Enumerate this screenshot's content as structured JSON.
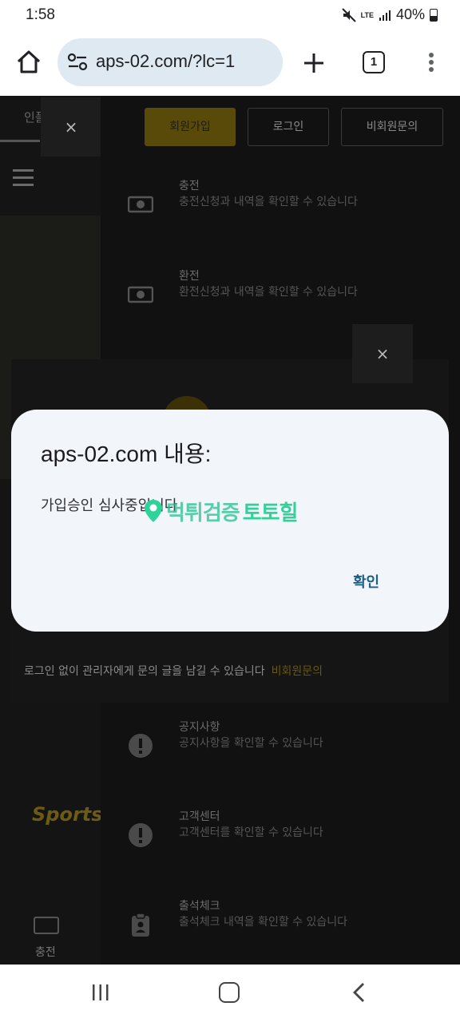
{
  "status_bar": {
    "time": "1:58",
    "network": "LTE",
    "battery": "40%"
  },
  "browser": {
    "url": "aps-02.com/?lc=1",
    "tab_count": "1"
  },
  "page": {
    "left_strip": {
      "tab_label": "인플",
      "sports_label": "Sports",
      "footer_label": "충전"
    },
    "close_symbol": "×",
    "auth_buttons": {
      "signup": "회원가입",
      "login": "로그인",
      "guest_inquiry": "비회원문의"
    },
    "menu_items": [
      {
        "title": "충전",
        "desc": "충전신청과 내역을 확인할 수 있습니다",
        "icon": "money-icon"
      },
      {
        "title": "환전",
        "desc": "환전신청과 내역을 확인할 수 있습니다",
        "icon": "money-icon"
      },
      {
        "title": "공지사항",
        "desc": "공지사항을 확인할 수 있습니다",
        "icon": "alert-icon"
      },
      {
        "title": "고객센터",
        "desc": "고객센터를 확인할 수 있습니다",
        "icon": "alert-icon"
      },
      {
        "title": "출석체크",
        "desc": "출석체크 내역을 확인할 수 있습니다",
        "icon": "clipboard-icon"
      }
    ],
    "under_modal": {
      "footer_text": "로그인 없이 관리자에게 문의 글을 남길 수 있습니다",
      "footer_link": "비회원문의"
    }
  },
  "dialog": {
    "title": "aps-02.com 내용:",
    "message": "가입승인 심사중입니다",
    "ok_label": "확인"
  },
  "watermark": {
    "part1": "먹튀검증",
    "part2": "토토힐"
  },
  "colors": {
    "accent_gold": "#f5c518",
    "dialog_bg": "#f2f6fb",
    "dialog_button": "#1d5f86",
    "watermark": "#2fd39a"
  }
}
